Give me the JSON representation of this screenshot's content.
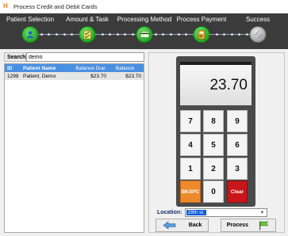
{
  "window": {
    "title": "Process Credit and Debit Cards",
    "icon_letters": "H"
  },
  "wizard": {
    "steps": [
      {
        "label": "Patient Selection",
        "icon": "person-icon"
      },
      {
        "label": "Amount & Task",
        "icon": "checklist-icon"
      },
      {
        "label": "Processing Method",
        "icon": "card-icon"
      },
      {
        "label": "Process Payment",
        "icon": "card-reader-icon"
      },
      {
        "label": "Success",
        "icon": "sparkle-icon"
      }
    ]
  },
  "search": {
    "label": "Search",
    "value": "demo"
  },
  "grid": {
    "headers": {
      "id": "ID",
      "name": "Patient Name",
      "due": "Balance Due",
      "balance": "Balance"
    },
    "rows": [
      {
        "id": "1298",
        "name": "Patient, Demo",
        "due": "$23.70",
        "balance": "$23.70"
      }
    ]
  },
  "keypad": {
    "display": "23.70",
    "keys": [
      "7",
      "8",
      "9",
      "4",
      "5",
      "6",
      "1",
      "2",
      "3",
      "0"
    ],
    "backspace": "BKSPC",
    "clear": "Clear"
  },
  "location": {
    "label": "Location:",
    "value": "29th st."
  },
  "buttons": {
    "back": "Back",
    "process": "Process"
  },
  "colors": {
    "accent": "#4a90e2",
    "step_active": "#26a626",
    "bkspc": "#ee8a2c",
    "clear": "#c8161b"
  }
}
